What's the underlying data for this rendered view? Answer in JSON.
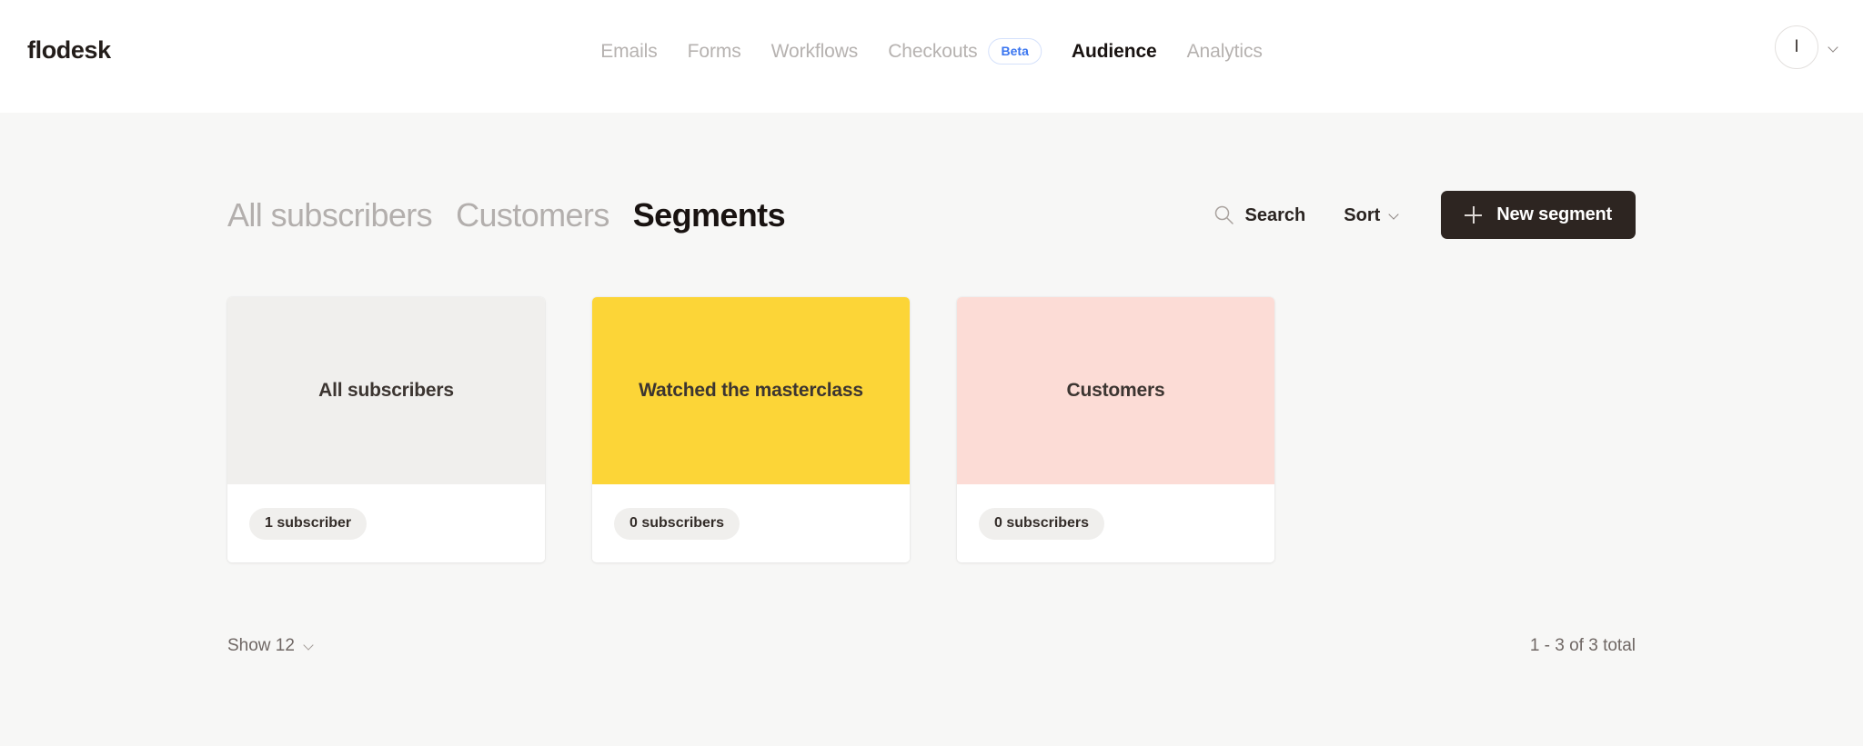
{
  "header": {
    "brand": "flodesk",
    "nav": [
      {
        "label": "Emails",
        "active": false
      },
      {
        "label": "Forms",
        "active": false
      },
      {
        "label": "Workflows",
        "active": false
      },
      {
        "label": "Checkouts",
        "active": false,
        "badge": "Beta"
      },
      {
        "label": "Audience",
        "active": true
      },
      {
        "label": "Analytics",
        "active": false
      }
    ],
    "account": {
      "initial": "I",
      "chevron_icon": "chevron-down-icon"
    }
  },
  "subtabs": [
    {
      "label": "All subscribers",
      "active": false
    },
    {
      "label": "Customers",
      "active": false
    },
    {
      "label": "Segments",
      "active": true
    }
  ],
  "toolbar": {
    "search_label": "Search",
    "search_icon": "search-icon",
    "sort_label": "Sort",
    "sort_chevron_icon": "chevron-down-icon",
    "new_segment_label": "New segment",
    "new_segment_icon": "plus-icon",
    "new_segment_bg": "#2d2521"
  },
  "segments": [
    {
      "title": "All subscribers",
      "count_label": "1 subscriber",
      "thumb_color": "#f0efed"
    },
    {
      "title": "Watched the masterclass",
      "count_label": "0 subscribers",
      "thumb_color": "#fcd537"
    },
    {
      "title": "Customers",
      "count_label": "0 subscribers",
      "thumb_color": "#fcdcd6"
    }
  ],
  "footer": {
    "show_label": "Show 12",
    "show_chevron_icon": "chevron-down-icon",
    "pager_label": "1 - 3 of 3 total"
  }
}
